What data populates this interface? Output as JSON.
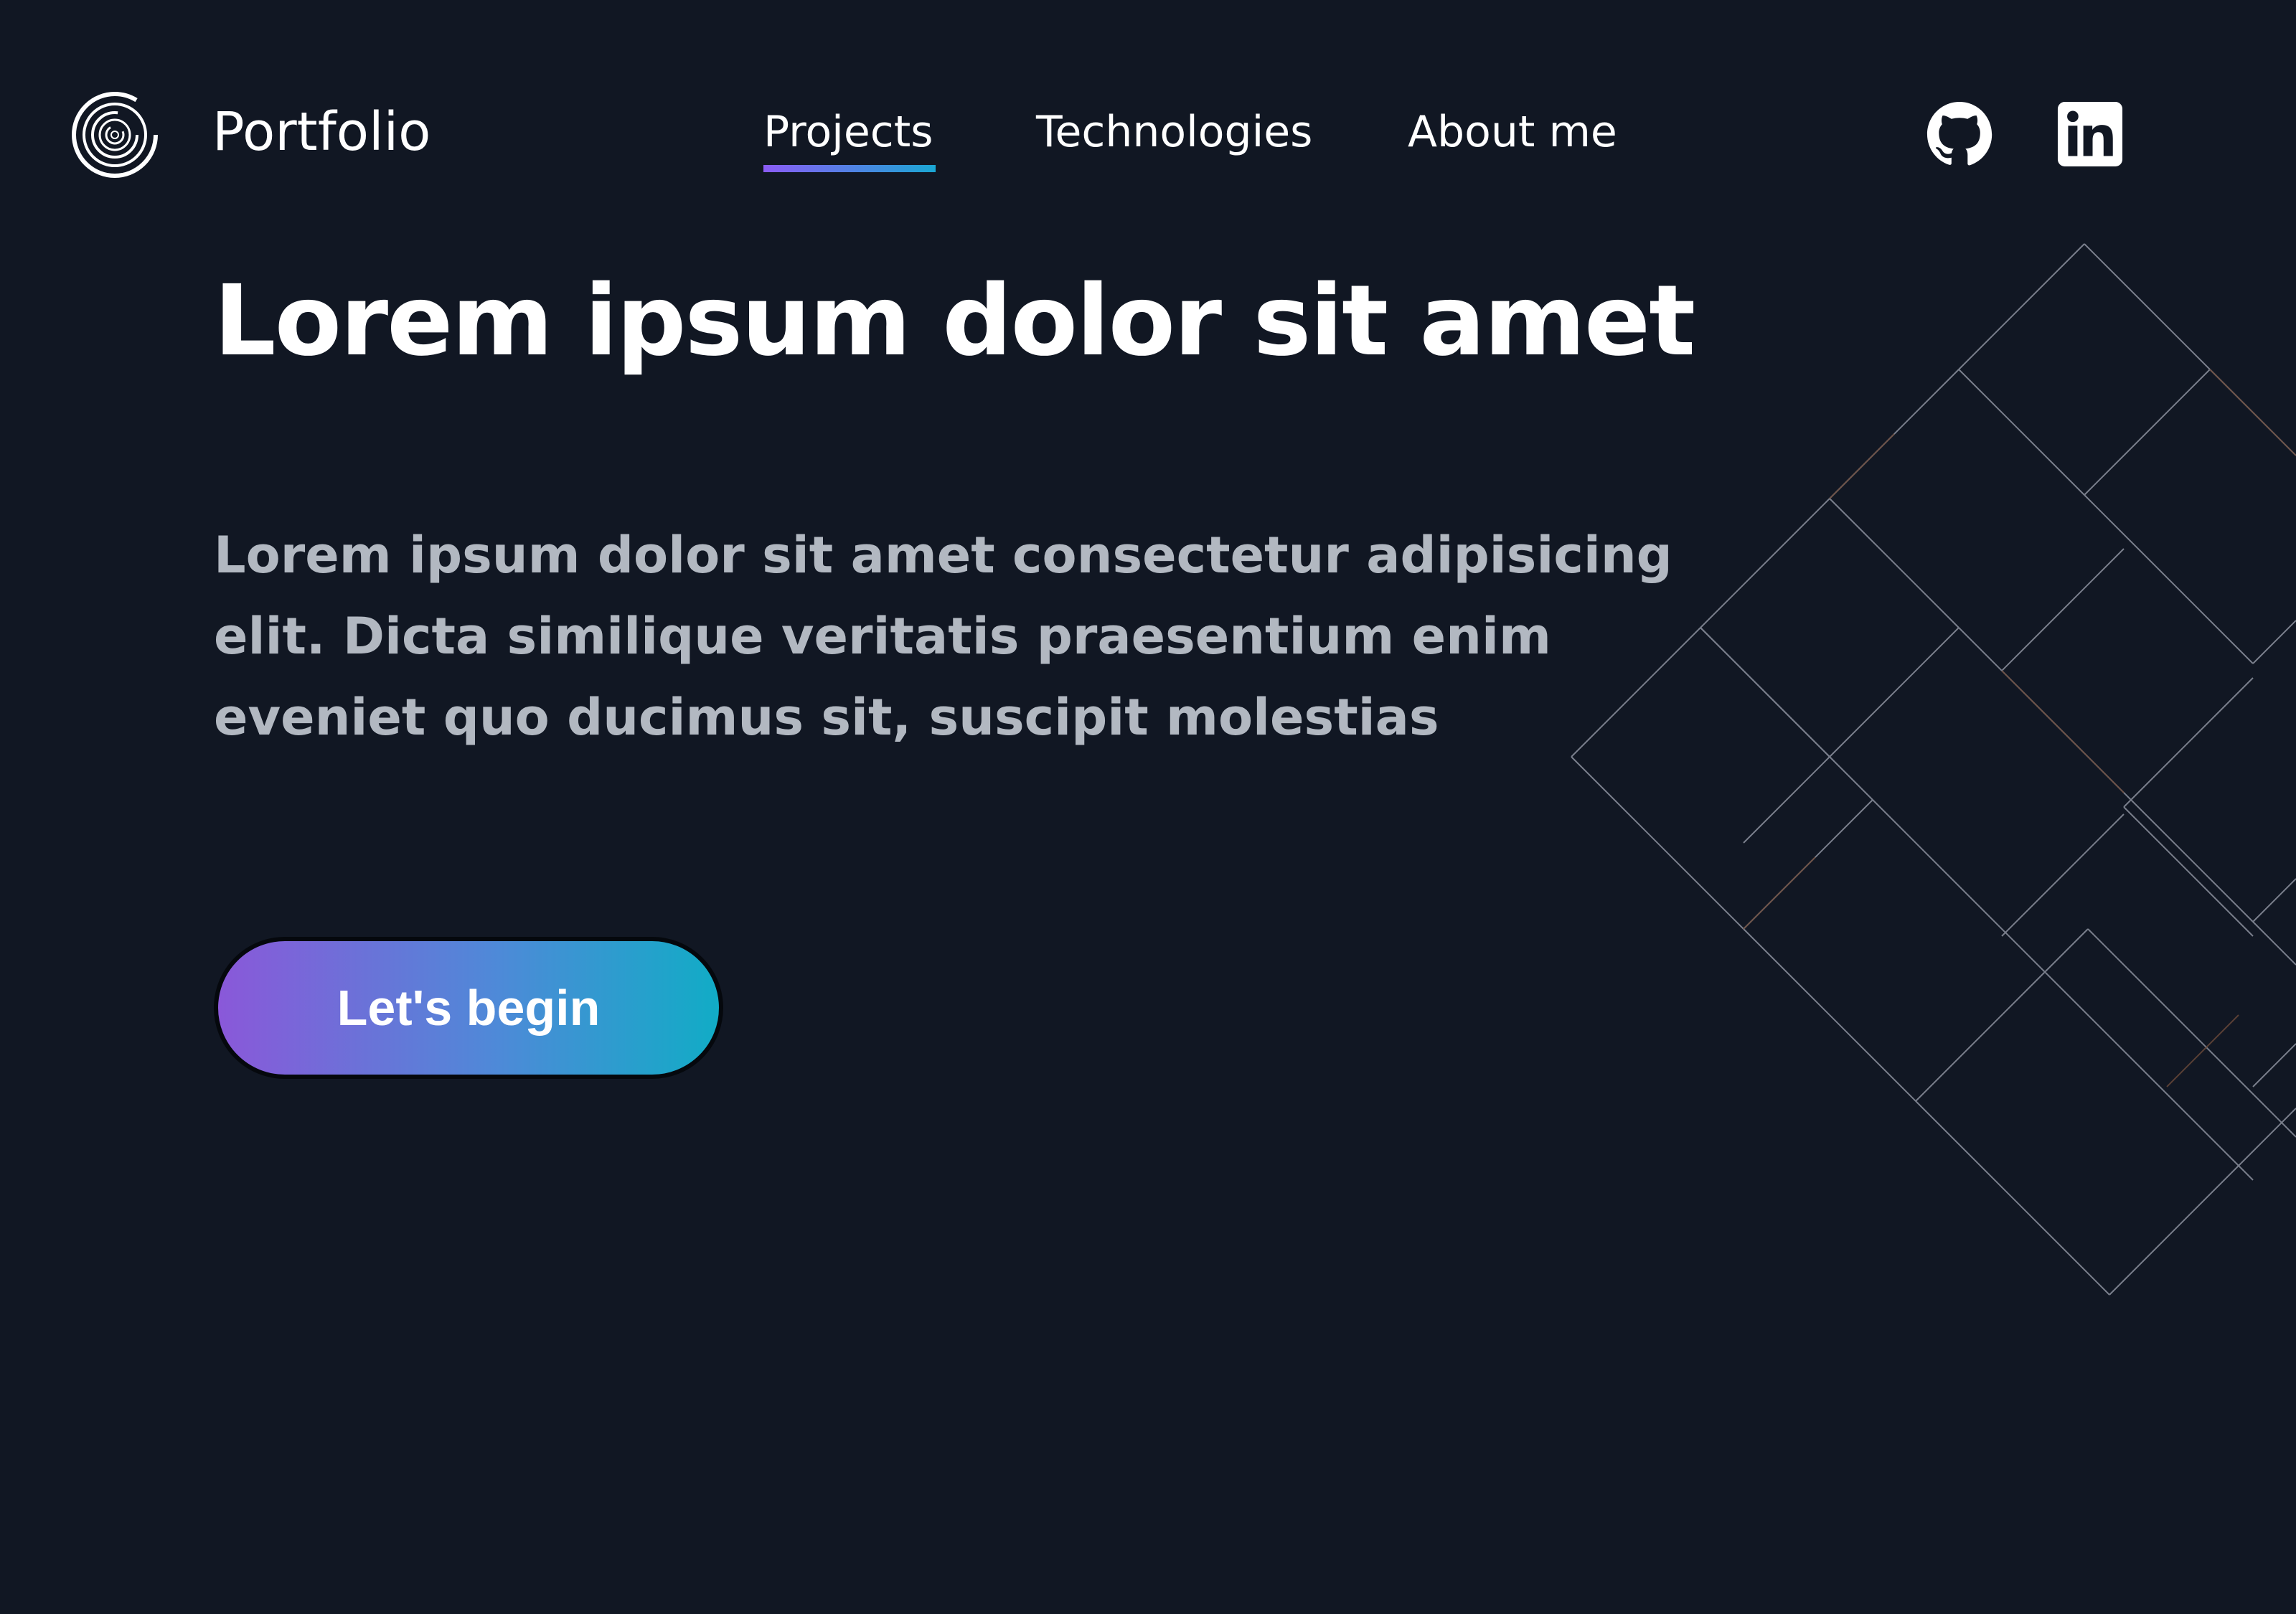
{
  "header": {
    "brand": "Portfolio",
    "logo_icon": "spiral-logo-icon",
    "nav": {
      "items": [
        {
          "label": "Projects",
          "active": true
        },
        {
          "label": "Technologies",
          "active": false
        },
        {
          "label": "About me",
          "active": false
        }
      ]
    },
    "social": {
      "github_icon": "github-icon",
      "linkedin_icon": "linkedin-icon"
    }
  },
  "hero": {
    "title": "Lorem ipsum dolor sit amet",
    "paragraph": "Lorem ipsum dolor sit amet consectetur adipisicing elit. Dicta similique veritatis praesentium enim eveniet quo ducimus sit, suscipit molestias",
    "cta_label": "Let's begin"
  },
  "theme": {
    "background": "#111723",
    "accent_start": "#8a58d9",
    "accent_end": "#11acc6",
    "text_primary": "#ffffff",
    "text_secondary": "#b2b8c1"
  }
}
